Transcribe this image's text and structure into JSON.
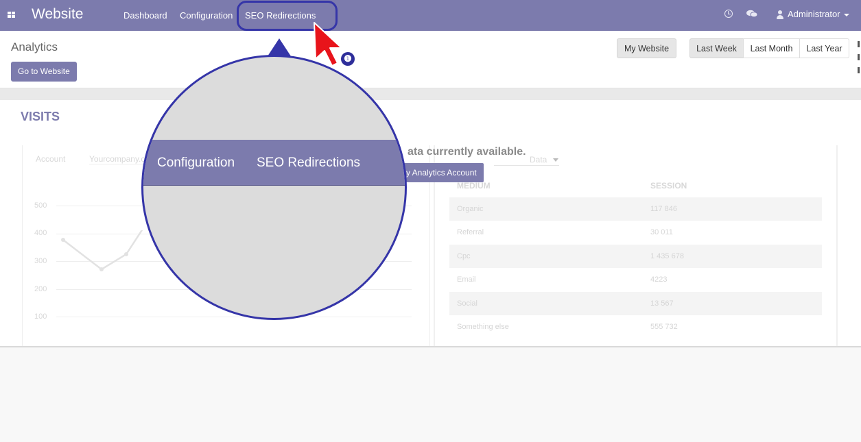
{
  "navbar": {
    "brand": "Website",
    "menu": [
      "Dashboard",
      "Configuration",
      "SEO Redirections"
    ],
    "user": "Administrator"
  },
  "control_panel": {
    "breadcrumb": "Analytics",
    "go_to_website": "Go to Website",
    "my_website": "My Website",
    "date_ranges": [
      "Last Week",
      "Last Month",
      "Last Year"
    ]
  },
  "visits": {
    "title": "VISITS",
    "account_label": "Account",
    "account_value": "Yourcompany.c",
    "no_data": "ata currently available.",
    "analytics_button": "y Analytics Account",
    "dropdown_value": "Data",
    "y_ticks": [
      "500",
      "400",
      "300",
      "200",
      "100"
    ],
    "table": {
      "headers": [
        "MEDIUM",
        "SESSION"
      ],
      "rows": [
        [
          "Organic",
          "117 846"
        ],
        [
          "Referral",
          "30 011"
        ],
        [
          "Cpc",
          "1 435 678"
        ],
        [
          "Email",
          "4223"
        ],
        [
          "Social",
          "13 567"
        ],
        [
          "Something else",
          "555 732"
        ]
      ]
    }
  },
  "magnifier": {
    "items": [
      "Configuration",
      "SEO Redirections"
    ]
  },
  "annotation": {
    "step": "❶"
  },
  "colors": {
    "brand": "#7c7bad",
    "annotation": "#3535a8",
    "cursor": "#e8141b"
  }
}
